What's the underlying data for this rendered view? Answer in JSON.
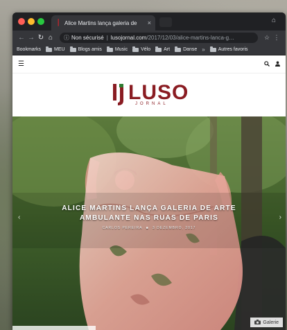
{
  "browser": {
    "tab_title": "Alice Martins lança galeria de",
    "tab_close": "×",
    "url_info": "Non sécurisé",
    "url_separator": "|",
    "url_host": "lusojornal.com",
    "url_path": "/2017/12/03/alice-martins-lanca-g…",
    "bookmarks": [
      {
        "label": "Bookmarks",
        "folder": false
      },
      {
        "label": "MEU",
        "folder": true
      },
      {
        "label": "Blogs amis",
        "folder": true
      },
      {
        "label": "Music",
        "folder": true
      },
      {
        "label": "Vélo",
        "folder": true
      },
      {
        "label": "Art",
        "folder": true
      },
      {
        "label": "Danse",
        "folder": true
      },
      {
        "label": "Autres favoris",
        "folder": true
      }
    ],
    "bookmarks_more": "»"
  },
  "site": {
    "logo_text": "LUSO",
    "logo_sub": "JORNAL",
    "brand_color": "#8a1c22"
  },
  "hero": {
    "title": "ALICE MARTINS LANÇA GALERIA DE ARTE AMBULANTE NAS RUAS DE PARIS",
    "author": "CARLOS PEREIRA",
    "separator": "■",
    "date": "3 DEZEMBRO, 2017",
    "gallery_label": "Galerie"
  },
  "icons": {
    "menu": "hamburger-icon",
    "search": "search-icon",
    "user": "user-icon",
    "camera": "camera-icon"
  }
}
